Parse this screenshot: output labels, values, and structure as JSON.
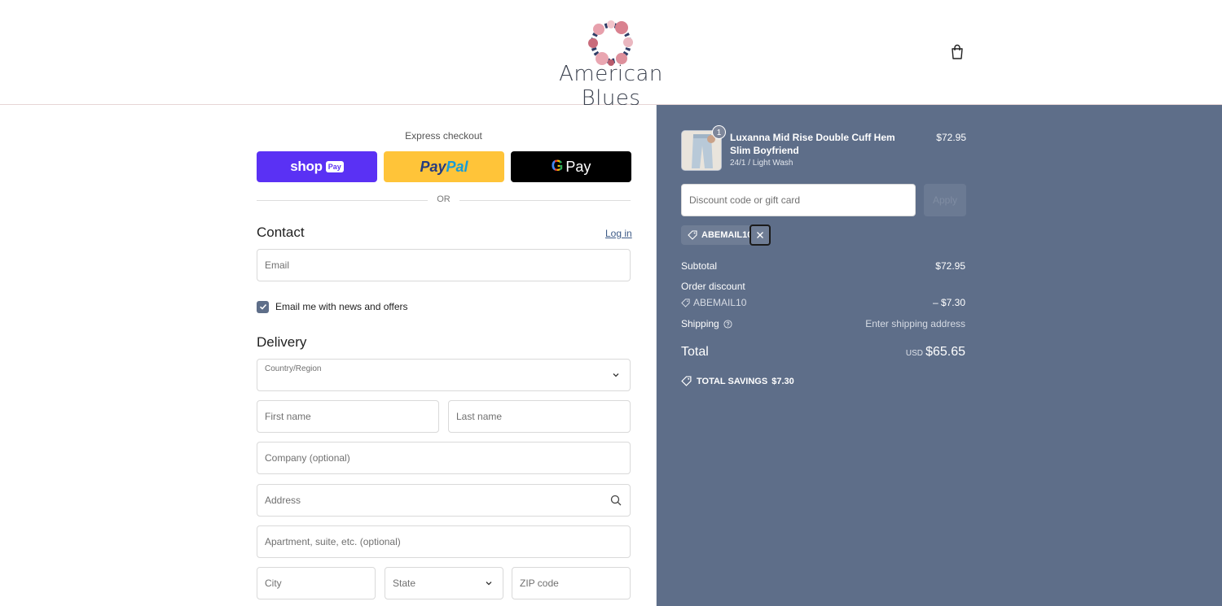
{
  "brand": {
    "name": "American Blues"
  },
  "express": {
    "title": "Express checkout",
    "shop_pay": {
      "word": "shop",
      "badge": "Pay"
    },
    "paypal": {
      "part1": "Pay",
      "part2": "Pal"
    },
    "gpay": {
      "g": "G",
      "word": "Pay"
    },
    "or": "OR"
  },
  "contact": {
    "title": "Contact",
    "login": "Log in",
    "email_placeholder": "Email",
    "newsletter_label": "Email me with news and offers",
    "newsletter_checked": true
  },
  "delivery": {
    "title": "Delivery",
    "country_label": "Country/Region",
    "country_value": "",
    "first_name": "First name",
    "last_name": "Last name",
    "company": "Company (optional)",
    "address": "Address",
    "apartment": "Apartment, suite, etc. (optional)",
    "city": "City",
    "state": "State",
    "zip": "ZIP code"
  },
  "summary": {
    "item": {
      "quantity": "1",
      "name": "Luxanna Mid Rise Double Cuff Hem Slim Boyfriend",
      "variant": "24/1 / Light Wash",
      "price": "$72.95"
    },
    "discount_placeholder": "Discount code or gift card",
    "apply_label": "Apply",
    "applied_code": "ABEMAIL10",
    "subtotal_label": "Subtotal",
    "subtotal_value": "$72.95",
    "order_discount_label": "Order discount",
    "discount_code": "ABEMAIL10",
    "discount_value": "– $7.30",
    "shipping_label": "Shipping",
    "shipping_value": "Enter shipping address",
    "total_label": "Total",
    "currency": "USD",
    "total_value": "$65.65",
    "savings_label": "TOTAL SAVINGS",
    "savings_value": "$7.30"
  },
  "colors": {
    "summary_bg": "#5e6e89",
    "shop_pay": "#5a31f4",
    "paypal": "#ffc439",
    "gpay": "#000000"
  }
}
